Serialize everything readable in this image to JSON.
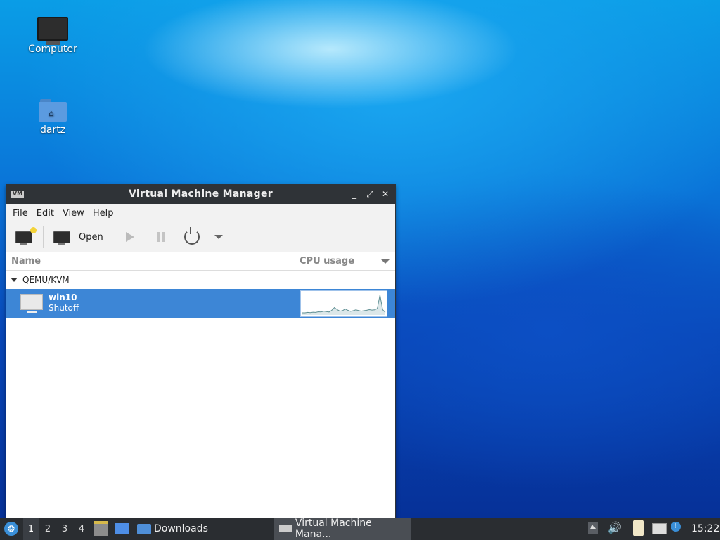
{
  "desktop": {
    "icons": [
      {
        "label": "Computer",
        "icon": "computer-icon"
      },
      {
        "label": "dartz",
        "icon": "home-folder-icon"
      }
    ]
  },
  "window": {
    "title": "Virtual Machine Manager",
    "app_icon_text": "VM",
    "controls": {
      "minimize": "_",
      "maximize": "⤢",
      "close": "✕"
    },
    "menu": [
      "File",
      "Edit",
      "View",
      "Help"
    ],
    "toolbar": {
      "new_vm_icon": "new-vm-icon",
      "open_label": "Open",
      "run_icon": "play-icon",
      "pause_icon": "pause-icon",
      "shutdown_icon": "power-icon",
      "shutdown_menu_icon": "chevron-down-icon"
    },
    "columns": {
      "name": "Name",
      "cpu": "CPU usage"
    },
    "connection": {
      "label": "QEMU/KVM",
      "expanded": true
    },
    "vms": [
      {
        "name": "win10",
        "status": "Shutoff",
        "selected": true,
        "cpu_sparkline": [
          0.1,
          0.1,
          0.12,
          0.11,
          0.13,
          0.12,
          0.15,
          0.14,
          0.18,
          0.16,
          0.14,
          0.22,
          0.35,
          0.25,
          0.18,
          0.2,
          0.28,
          0.22,
          0.17,
          0.2,
          0.24,
          0.21,
          0.18,
          0.2,
          0.22,
          0.25,
          0.23,
          0.24,
          0.3,
          0.95,
          0.25,
          0.12
        ]
      }
    ]
  },
  "taskbar": {
    "start_icon": "start-menu-icon",
    "workspaces": [
      "1",
      "2",
      "3",
      "4"
    ],
    "active_workspace": "1",
    "quicklaunch": [
      {
        "icon": "file-manager-icon"
      },
      {
        "icon": "show-desktop-icon"
      }
    ],
    "downloads_label": "Downloads",
    "task_label": "Virtual Machine Mana...",
    "tray": [
      "tray-arrow-icon",
      "volume-icon",
      "clipboard-icon",
      "network-icon",
      "update-icon"
    ],
    "clock": "15:22"
  }
}
